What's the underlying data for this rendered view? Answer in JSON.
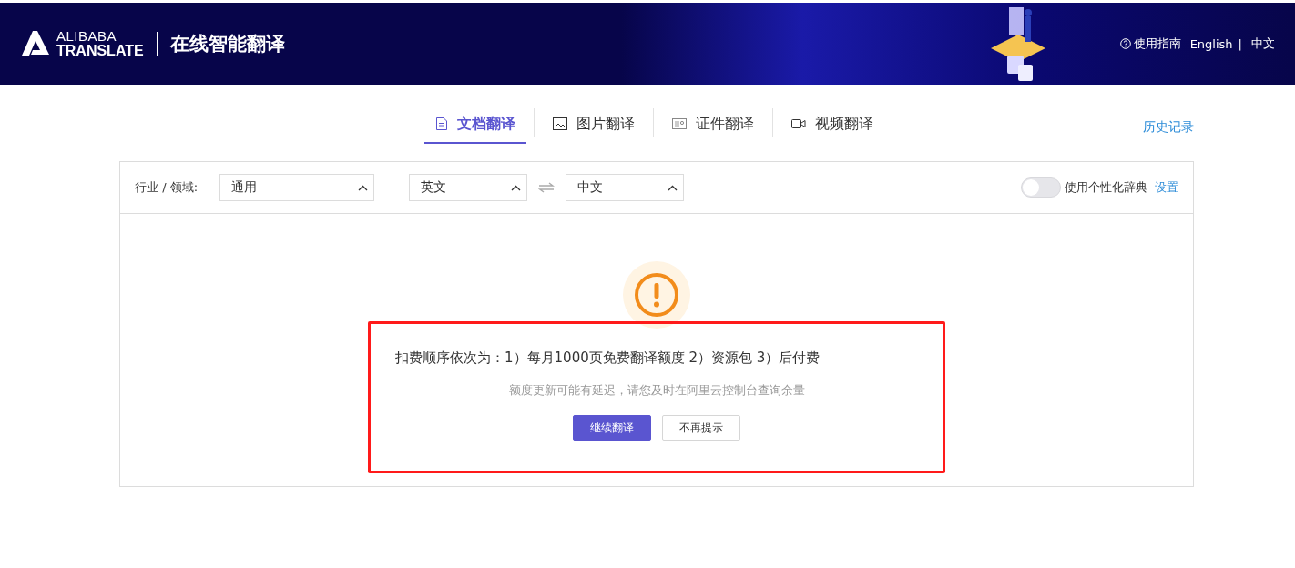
{
  "header": {
    "logo_top": "ALIBABA",
    "logo_bottom": "TRANSLATE",
    "title": "在线智能翻译",
    "links": [
      {
        "kind": "help",
        "label": "使用指南"
      },
      {
        "kind": "lang",
        "label": "English"
      },
      {
        "kind": "sep",
        "label": "|"
      },
      {
        "kind": "lang",
        "label": "中文"
      }
    ]
  },
  "tabs": [
    {
      "label": "文档翻译",
      "kind": "document",
      "selected": true
    },
    {
      "label": "图片翻译",
      "kind": "image",
      "selected": false
    },
    {
      "label": "证件翻译",
      "kind": "id-card",
      "selected": false
    },
    {
      "label": "视频翻译",
      "kind": "video",
      "selected": false
    }
  ],
  "history_link": "历史记录",
  "toolbar": {
    "domain_label": "行业 / 领域:",
    "domain": "通用",
    "source_language": "英文",
    "target_language": "中文",
    "dictionary_toggle": {
      "label": "使用个性化辞典",
      "on": false
    },
    "settings_link": "设置"
  },
  "notice": {
    "message": "扣费顺序依次为：1）每月1000页免费翻译额度 2）资源包 3）后付费",
    "hint": "额度更新可能有延迟，请您及时在阿里云控制台查询余量",
    "buttons": [
      {
        "label": "继续翻译",
        "kind": "primary"
      },
      {
        "label": "不再提示",
        "kind": "default"
      }
    ]
  }
}
